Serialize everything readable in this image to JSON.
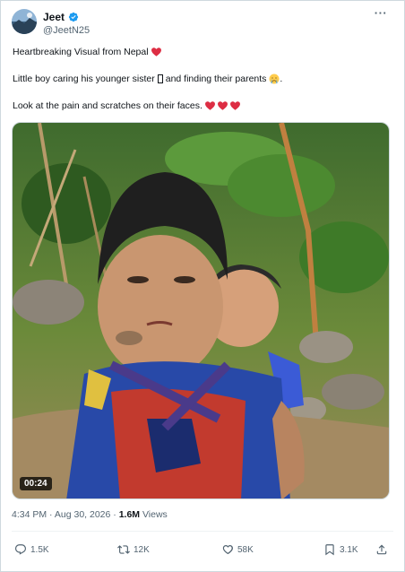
{
  "author": {
    "display_name": "Jeet",
    "handle": "@JeetN25",
    "verified_color": "#1d9bf0"
  },
  "icons": {
    "more": "more-icon",
    "verified": "verified-badge-icon",
    "reply": "reply-icon",
    "repost": "repost-icon",
    "like": "like-icon",
    "bookmark": "bookmark-icon",
    "share": "share-icon"
  },
  "more_label": "···",
  "tweet": {
    "line1": "Heartbreaking Visual from Nepal",
    "line2_a": "Little boy caring his younger sister",
    "line2_b": "and finding their parents",
    "line2_end": ".",
    "line3": "Look at the pain and scratches on their faces."
  },
  "colors": {
    "heart": "#dd2e44",
    "accent": "#1d9bf0"
  },
  "media": {
    "kind": "video",
    "duration": "00:24"
  },
  "meta": {
    "time": "4:34 PM",
    "separator": "·",
    "date": "Aug 30, 2026",
    "views_count": "1.6M",
    "views_label": "Views"
  },
  "actions": {
    "replies": "1.5K",
    "reposts": "12K",
    "likes": "58K",
    "bookmarks": "3.1K"
  }
}
